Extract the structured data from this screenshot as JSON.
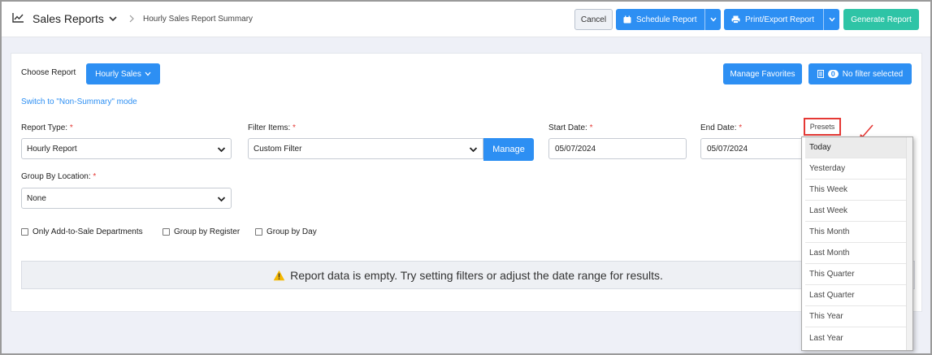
{
  "header": {
    "title": "Sales Reports",
    "breadcrumb": "Hourly Sales Report Summary",
    "icons": {
      "brand": "line-chart-icon",
      "dropdown": "chevron-down-icon",
      "separator": "chevron-right-icon"
    }
  },
  "toolbar": {
    "cancel_label": "Cancel",
    "schedule_label": "Schedule Report",
    "print_label": "Print/Export Report",
    "generate_label": "Generate Report"
  },
  "colors": {
    "primary": "#2d8ff3",
    "success": "#2ec4a6",
    "required": "#e53935",
    "highlight": "#e53935"
  },
  "report": {
    "choose_label": "Choose Report",
    "selected_report": "Hourly Sales",
    "manage_favorites_label": "Manage Favorites",
    "filter_count": "0",
    "filter_status": "No filter selected",
    "mode_link": "Switch to \"Non-Summary\" mode"
  },
  "fields": {
    "report_type": {
      "label": "Report Type:",
      "value": "Hourly Report",
      "required": "*"
    },
    "filter_items": {
      "label": "Filter Items:",
      "value": "Custom Filter",
      "required": "*",
      "manage_label": "Manage"
    },
    "start_date": {
      "label": "Start Date:",
      "value": "05/07/2024",
      "required": "*"
    },
    "end_date": {
      "label": "End Date:",
      "value": "05/07/2024",
      "required": "*"
    },
    "group_by_location": {
      "label": "Group By Location:",
      "value": "None",
      "required": "*"
    }
  },
  "checkboxes": [
    {
      "label": "Only Add-to-Sale Departments",
      "checked": false
    },
    {
      "label": "Group by Register",
      "checked": false
    },
    {
      "label": "Group by Day",
      "checked": false
    }
  ],
  "empty_message": "Report data is empty. Try setting filters or adjust the date range for results.",
  "presets": {
    "label": "Presets",
    "options": [
      "Today",
      "Yesterday",
      "This Week",
      "Last Week",
      "This Month",
      "Last Month",
      "This Quarter",
      "Last Quarter",
      "This Year",
      "Last Year"
    ],
    "active": "Today"
  }
}
